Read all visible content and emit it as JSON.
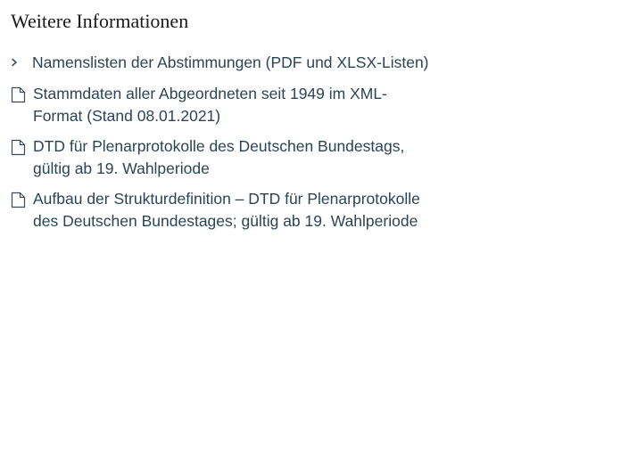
{
  "section": {
    "title": "Weitere Informationen"
  },
  "links": [
    {
      "label": "Namenslisten der Abstimmungen (PDF und XLSX-Listen)",
      "icon": "chevron-right-icon"
    },
    {
      "label": "Stammdaten aller Abgeordneten seit 1949 im XML-Format (Stand 08.01.2021)",
      "icon": "document-icon"
    },
    {
      "label": "DTD für Plenarprotokolle des Deutschen Bundestags, gültig ab 19. Wahlperiode",
      "icon": "document-icon"
    },
    {
      "label": "Aufbau der Strukturdefinition – DTD für Plenarprotokolle des Deutschen Bundestages; gültig ab 19. Wahlperiode",
      "icon": "document-icon"
    }
  ]
}
